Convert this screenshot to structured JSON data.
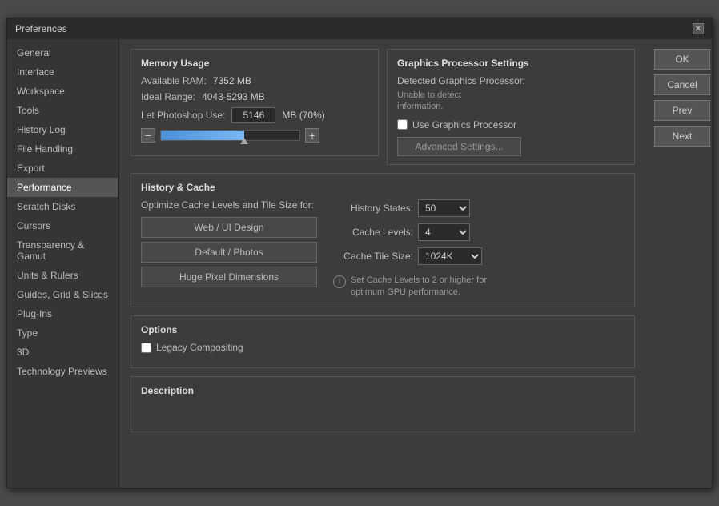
{
  "dialog": {
    "title": "Preferences",
    "close_label": "✕"
  },
  "sidebar": {
    "items": [
      {
        "label": "General",
        "active": false
      },
      {
        "label": "Interface",
        "active": false
      },
      {
        "label": "Workspace",
        "active": false
      },
      {
        "label": "Tools",
        "active": false
      },
      {
        "label": "History Log",
        "active": false
      },
      {
        "label": "File Handling",
        "active": false
      },
      {
        "label": "Export",
        "active": false
      },
      {
        "label": "Performance",
        "active": true
      },
      {
        "label": "Scratch Disks",
        "active": false
      },
      {
        "label": "Cursors",
        "active": false
      },
      {
        "label": "Transparency & Gamut",
        "active": false
      },
      {
        "label": "Units & Rulers",
        "active": false
      },
      {
        "label": "Guides, Grid & Slices",
        "active": false
      },
      {
        "label": "Plug-Ins",
        "active": false
      },
      {
        "label": "Type",
        "active": false
      },
      {
        "label": "3D",
        "active": false
      },
      {
        "label": "Technology Previews",
        "active": false
      }
    ]
  },
  "buttons": {
    "ok": "OK",
    "cancel": "Cancel",
    "prev": "Prev",
    "next": "Next"
  },
  "memory_usage": {
    "title": "Memory Usage",
    "available_ram_label": "Available RAM:",
    "available_ram_value": "7352 MB",
    "ideal_range_label": "Ideal Range:",
    "ideal_range_value": "4043-5293 MB",
    "let_photoshop_use_label": "Let Photoshop Use:",
    "let_photoshop_use_value": "5146",
    "percent_label": "MB (70%)",
    "slider_fill_pct": 60
  },
  "graphics_processor": {
    "title": "Graphics Processor Settings",
    "detected_label": "Detected Graphics Processor:",
    "info_text": "Unable to detect\ninformation.",
    "use_gpu_label": "Use Graphics Processor",
    "use_gpu_checked": false,
    "advanced_btn": "Advanced Settings..."
  },
  "history_cache": {
    "title": "History & Cache",
    "optimize_label": "Optimize Cache Levels and Tile Size for:",
    "btn1": "Web / UI Design",
    "btn2": "Default / Photos",
    "btn3": "Huge Pixel Dimensions",
    "history_states_label": "History States:",
    "history_states_value": "50",
    "cache_levels_label": "Cache Levels:",
    "cache_levels_value": "4",
    "cache_tile_label": "Cache Tile Size:",
    "cache_tile_value": "1024K",
    "tip_text": "Set Cache Levels to 2 or higher for\noptimum GPU performance."
  },
  "options": {
    "title": "Options",
    "legacy_compositing_label": "Legacy Compositing",
    "legacy_compositing_checked": false
  },
  "description": {
    "title": "Description"
  }
}
